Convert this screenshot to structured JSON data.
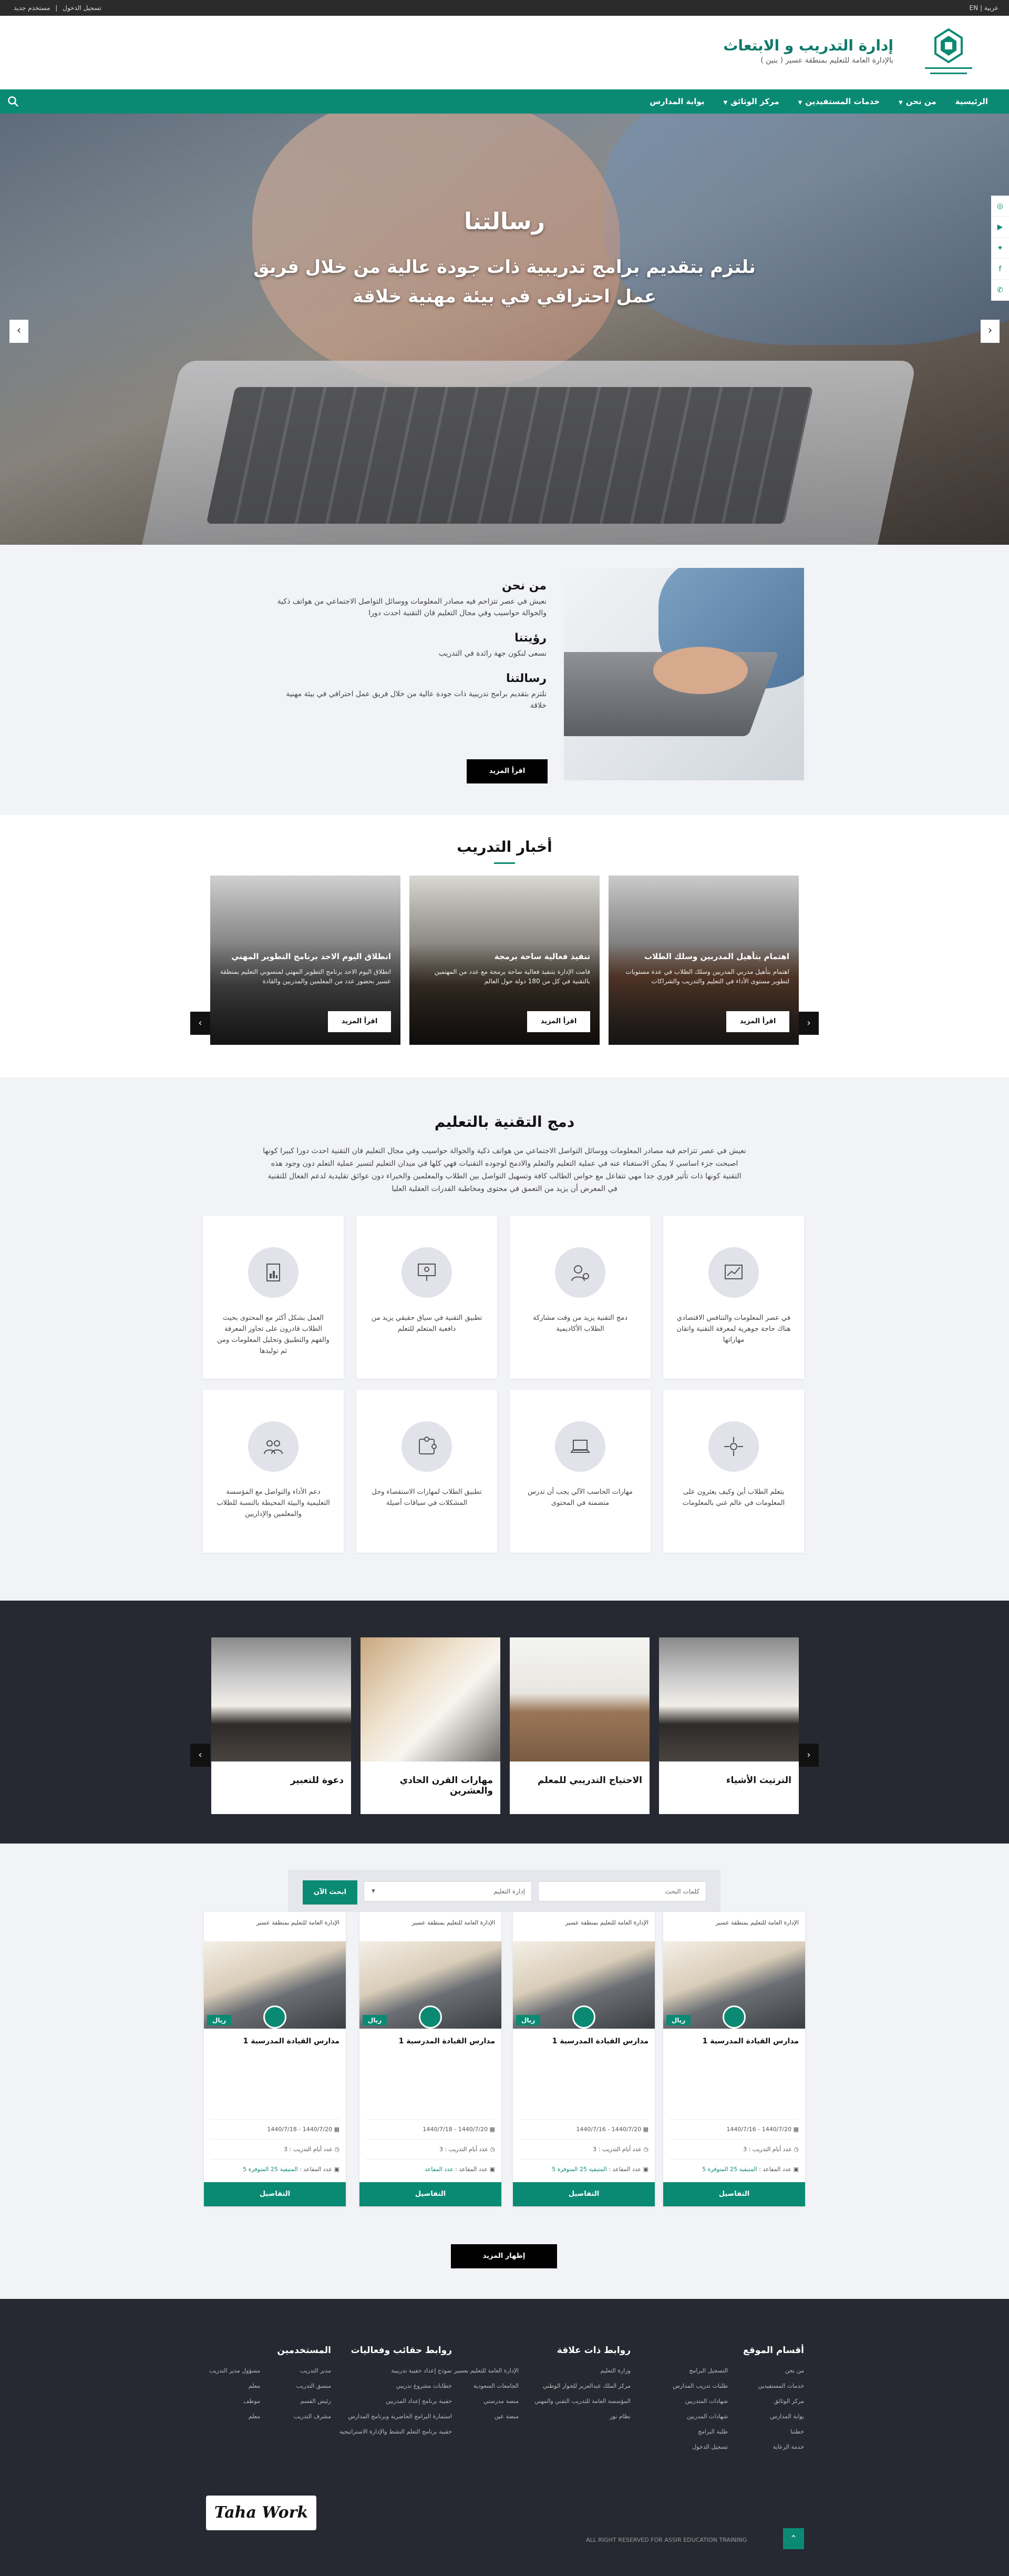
{
  "topbar": {
    "lang": "EN",
    "lang_alt": "عربية",
    "new_user": "مستخدم جديد",
    "separator": "|",
    "login": "تسجيل الدخول"
  },
  "header": {
    "title": "إدارة التدريب و الابتعاث",
    "subtitle": "بالإدارة العامة للتعليم بمنطقة عسير ( بنين )",
    "emblem_caption": "إدارة التدريب والابتعاث"
  },
  "nav": {
    "items": [
      "الرئيسية",
      "من نحن",
      "خدمات المستفيدين",
      "مركز الوثائق",
      "بوابة المدارس"
    ],
    "has_dropdown": [
      false,
      true,
      true,
      true,
      false
    ]
  },
  "hero": {
    "title": "رسالتنا",
    "text": "نلتزم بتقديم برامج تدريبية ذات جودة عالية من خلال فريق عمل احترافي في بيئة مهنية خلاقة",
    "prev": "‹",
    "next": "›"
  },
  "social": [
    "instagram-icon",
    "youtube-icon",
    "twitter-icon",
    "facebook-icon",
    "whatsapp-icon"
  ],
  "about": {
    "blocks": [
      {
        "title": "من نحن",
        "text": "نعيش في عصر تتزاحم فيه مصادر المعلومات ووسائل التواصل الاجتماعي من هواتف ذكية والجوالة حواسيب وفي مجال التعليم فان التقنية احدث دورا"
      },
      {
        "title": "رؤيتنا",
        "text": "نسعى لنكون جهة رائدة في التدريب"
      },
      {
        "title": "رسالتنا",
        "text": "نلتزم بتقديم برامج تدريبية ذات جودة عالية من خلال فريق عمل احترافي في بيئة مهنية خلاقة"
      }
    ],
    "button": "اقرأ المزيد"
  },
  "news": {
    "title": "أخبار التدريب",
    "prev": "‹",
    "next": "›",
    "items": [
      {
        "title": "اهتمام بتأهيل المدربين وسلك الطلاب",
        "text": "اهتمام بتأهيل مدربي المدربين وسلك الطلاب في عدة مستويات لتطوير مستوى الأداء في التعليم والتدريب والشراكات",
        "button": "اقرأ المزيد"
      },
      {
        "title": "تنفيذ فعالية ساحة برمجة",
        "text": "قامت الإدارة بتنفيذ فعالية ساحة برمجة مع عدد من المهتمين بالتقنية في كل من 180 دولة حول العالم",
        "button": "اقرأ المزيد"
      },
      {
        "title": "انطلاق اليوم الاحد برنامج التطوير المهني",
        "text": "انطلاق اليوم الاحد برنامج التطوير المهني لمنسوبي التعليم بمنطقة عسير بحضور عدد من المعلمين والمدربين والقادة",
        "button": "اقرأ المزيد"
      }
    ]
  },
  "integration": {
    "title": "دمج التقنية بالتعليم",
    "intro": "نعيش في عصر تتزاحم فيه مصادر المعلومات ووسائل التواصل الاجتماعي من هواتف ذكية والجوالة حواسيب وفي مجال التعليم فان التقنية احدث دورا كبيرا كونها اصبحت جزء اساسي لا يمكن الاستغناء عنه في عملية التعليم والتعلم والادمج لوجوده التقنيات فهي كلها في ميدان التعليم لتسير عملية التعلم دون وجود هذه التقنية كونها ذات تأثير فوري جدا مهي تتفاعل مع حواس الطالب كافة وتسهيل التواصل بين الطلاب والمعلمين والخبراء دون عوائق تقليدية لدعم الفعال للتقنية في المعرض أن يزيد من التعمق في محتوى ومخاطبة القدرات العقلية العليا",
    "features": [
      {
        "icon": "chart-icon",
        "text": "في عصر المعلومات والتنافس الاقتصادي هناك حاجة جوهرية لمعرفة التقنية واتقان مهاراتها"
      },
      {
        "icon": "user-gear-icon",
        "text": "دمج التقنية يزيد من وقت مشاركة الطلاب الأكاديمية"
      },
      {
        "icon": "presentation-icon",
        "text": "تطبيق التقنية في سياق حقيقي يزيد من دافعية المتعلم للتعلم"
      },
      {
        "icon": "document-chart-icon",
        "text": "العمل بشكل أكثر مع المحتوى بحيث الطلاب قادرون على تجاوز المعرفة والفهم والتطبيق وتحليل المعلومات ومن ثم توليدها"
      },
      {
        "icon": "network-icon",
        "text": "يتعلم الطلاب أين وكيف يعثرون على المعلومات في عالم غني بالمعلومات"
      },
      {
        "icon": "laptop-icon",
        "text": "مهارات الحاسب الآلي يجب أن تدرس متضمنة في المحتوى"
      },
      {
        "icon": "puzzle-icon",
        "text": "تطبيق الطلاب لمهارات الاستقصاء وحل المشكلات في سياقات أصيلة"
      },
      {
        "icon": "group-icon",
        "text": "دعم الأداء والتواصل مع المؤسسة التعليمية والبيئة المحيطة بالنسبة للطلاب والمعلمين والإداريين"
      }
    ]
  },
  "courses_slider": {
    "prev": "‹",
    "next": "›",
    "items": [
      {
        "title": "الترتيث الأشياء"
      },
      {
        "title": "الاحتياج التدريبي للمعلم"
      },
      {
        "title": "مهارات القرن الحادي والعشرين"
      },
      {
        "title": "دعوة للتعبير"
      }
    ]
  },
  "search": {
    "keyword_placeholder": "كلمات البحث",
    "department_value": "إدارة التعليم",
    "button": "ابحث الآن"
  },
  "course_cards": [
    {
      "org": "الإدارة العامة للتعليم بمنطقة عسير",
      "price": "ريال",
      "title": "مدارس القيادة المدرسية 1",
      "dates": "1440/7/20 - 1440/7/16",
      "trainer": "عدد أيام التدريب : 3",
      "seats_label": "عدد المقاعد :",
      "seats": "المتبقية 25 المتوفرة 5",
      "button": "التفاصيل"
    },
    {
      "org": "الإدارة العامة للتعليم بمنطقة عسير",
      "price": "ريال",
      "title": "مدارس القيادة المدرسية 1",
      "dates": "1440/7/20 - 1440/7/16",
      "trainer": "عدد أيام التدريب : 3",
      "seats_label": "عدد المقاعد :",
      "seats": "المتبقية 25 المتوفرة 5",
      "button": "التفاصيل"
    },
    {
      "org": "الإدارة العامة للتعليم بمنطقة عسير",
      "price": "ريال",
      "title": "مدارس القيادة المدرسية 1",
      "dates": "1440/7/20 - 1440/7/18",
      "trainer": "عدد أيام التدريب : 3",
      "seats_label": "عدد المقاعد :",
      "seats": "عدد المقاعد",
      "button": "التفاصيل"
    },
    {
      "org": "الإدارة العامة للتعليم بمنطقة عسير",
      "price": "ريال",
      "title": "مدارس القيادة المدرسية 1",
      "dates": "1440/7/20 - 1440/7/18",
      "trainer": "عدد أيام التدريب : 3",
      "seats_label": "عدد المقاعد :",
      "seats": "المتبقية 25 المتوفرة 5",
      "button": "التفاصيل"
    }
  ],
  "more_button": "إظهار المزيد",
  "footer": {
    "columns": [
      {
        "title": "أقسام الموقع",
        "links": [
          "من نحن",
          "التسجيل البرامج",
          "خدمات المستفيدين",
          "طلبات تدريب المدارس",
          "مركز الوثائق",
          "شهادات المتدربين",
          "بوابة المدارس",
          "شهادات المدربين",
          "خطتنا",
          "طلبة البرامج",
          "خدمة الرعاية",
          "تسجيل الدخول"
        ]
      },
      {
        "title": "روابط ذات علاقة",
        "links": [
          "وزارة التعليم",
          "الإدارة العامة للتعليم بعسير",
          "مركز الملك عبدالعزيز للحوار الوطني",
          "الجامعات السعودية",
          "المؤسسة العامة للتدريب التقني والمهني",
          "منصة مدرستي",
          "نظام نور",
          "منصة عين"
        ]
      },
      {
        "title": "روابط حقائب وفعاليات",
        "links": [
          "نموذج إعداد حقيبة تدريبية",
          "خطابات مشروع تدريبي",
          "حقيبة برنامج إعداد المدربين",
          "استمارة البرامج الحاضرية وبرنامج المدارس",
          "حقيبة برنامج التعلم النشط والإدارة الاستراتيجية"
        ]
      },
      {
        "title": "المستخدمين",
        "links": [
          "مدير التدريب",
          "منسق التدريب",
          "رئيس القسم",
          "مشرف التدريب",
          "مسؤول مدير التدريب",
          "معلم",
          "موظف",
          "معلم"
        ]
      }
    ],
    "copyright": "ALL RIGHT RESERVED FOR ASSIR EDUCATION TRAINING",
    "to_top": "⌃",
    "watermark": "Taha Work"
  },
  "colors": {
    "brand": "#0b8a73",
    "dark": "#262931",
    "light_bg": "#f2f3f6"
  }
}
